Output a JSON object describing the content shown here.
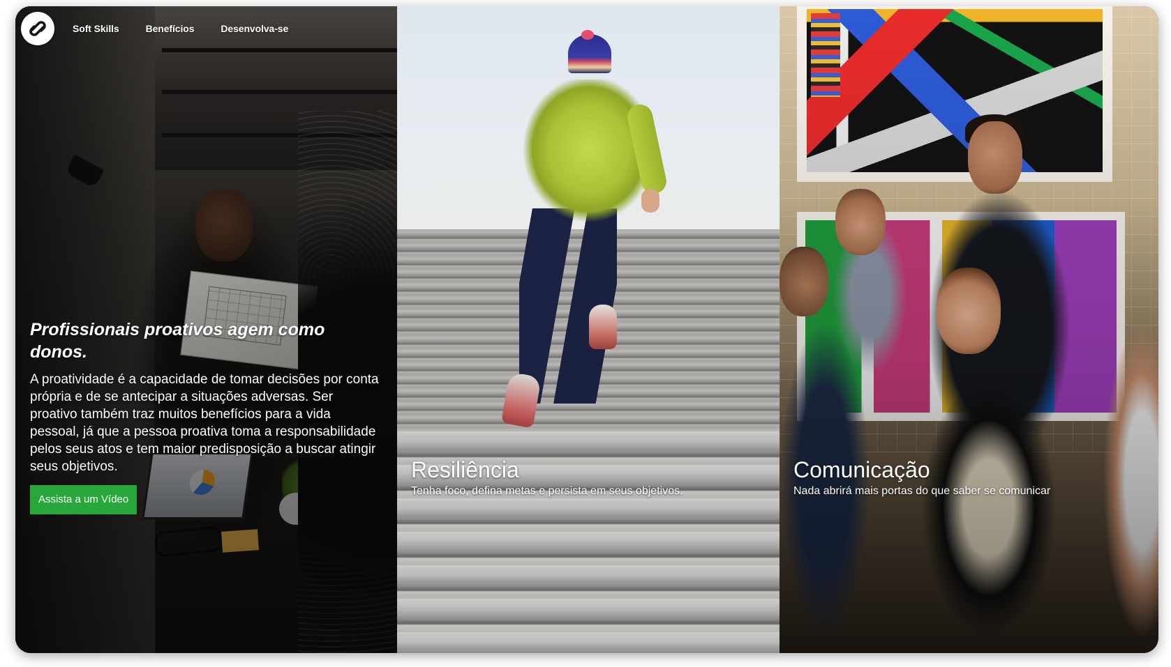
{
  "nav": {
    "items": [
      {
        "label": "Soft Skills"
      },
      {
        "label": "Benefícios"
      },
      {
        "label": "Desenvolva-se"
      }
    ]
  },
  "hero": {
    "title": "Profissionais proativos agem como donos.",
    "body": "A proatividade é a capacidade de tomar decisões por conta própria e de se antecipar a situações adversas. Ser proativo também traz muitos benefícios para a vida pessoal, já que a pessoa proativa toma a responsabilidade pelos seus atos e tem maior predisposição a buscar atingir seus objetivos.",
    "cta_label": "Assista a um Vídeo"
  },
  "panels": [
    {
      "title": "Resiliência",
      "subtitle": "Tenha foco, defina metas e persista em seus objetivos."
    },
    {
      "title": "Comunicação",
      "subtitle": "Nada abrirá mais portas do que saber se comunicar"
    }
  ],
  "colors": {
    "accent": "#28a83a",
    "text": "#ffffff"
  },
  "icons": {
    "logo": "link-logo-icon"
  }
}
